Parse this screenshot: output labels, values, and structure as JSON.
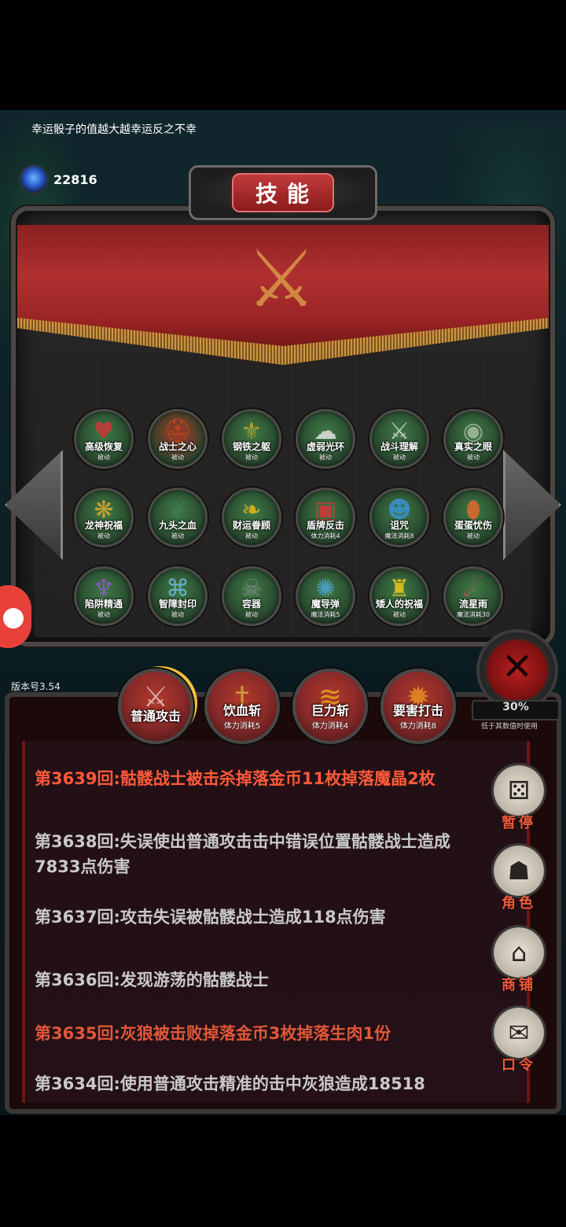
{
  "hint": "幸运骰子的值越大越幸运反之不幸",
  "currency": {
    "icon": "blue-gem-icon",
    "amount": "22816"
  },
  "panel": {
    "title": "技能"
  },
  "skills": [
    {
      "name": "高级恢复",
      "sub": "被动",
      "icon": "heart-icon",
      "bg": "#3f7a46"
    },
    {
      "name": "战士之心",
      "sub": "被动",
      "icon": "helmet-icon",
      "bg": "#a33a28"
    },
    {
      "name": "钢铁之躯",
      "sub": "被动",
      "icon": "armor-icon",
      "bg": "#3f7a46"
    },
    {
      "name": "虚弱光环",
      "sub": "被动",
      "icon": "ghost-icon",
      "bg": "#3f7a46"
    },
    {
      "name": "战斗理解",
      "sub": "被动",
      "icon": "sword-icon",
      "bg": "#3f7a46"
    },
    {
      "name": "真实之眼",
      "sub": "被动",
      "icon": "eye-icon",
      "bg": "#3f7a46"
    },
    {
      "name": "龙神祝福",
      "sub": "被动",
      "icon": "dragon-icon",
      "bg": "#3f7a46"
    },
    {
      "name": "九头之血",
      "sub": "被动",
      "icon": "hydra-icon",
      "bg": "#3f7a46"
    },
    {
      "name": "财运眷顾",
      "sub": "被动",
      "icon": "golden-wings-icon",
      "bg": "#3f7a46"
    },
    {
      "name": "盾牌反击",
      "sub": "体力消耗4",
      "icon": "shield-icon",
      "bg": "#3f7a46"
    },
    {
      "name": "诅咒",
      "sub": "魔法消耗8",
      "icon": "mask-icon",
      "bg": "#3f7a46"
    },
    {
      "name": "蛋蛋忧伤",
      "sub": "被动",
      "icon": "cracked-egg-icon",
      "bg": "#3f7a46"
    },
    {
      "name": "陷阱精通",
      "sub": "被动",
      "icon": "trap-icon",
      "bg": "#3f7a46"
    },
    {
      "name": "智障封印",
      "sub": "被动",
      "icon": "seal-icon",
      "bg": "#3f7a46"
    },
    {
      "name": "容器",
      "sub": "被动",
      "icon": "horned-skull-icon",
      "bg": "#3f7a46"
    },
    {
      "name": "魔导弹",
      "sub": "魔法消耗5",
      "icon": "magic-burst-icon",
      "bg": "#3f7a46"
    },
    {
      "name": "矮人的祝福",
      "sub": "被动",
      "icon": "dwarf-helmet-icon",
      "bg": "#3f7a46"
    },
    {
      "name": "流星雨",
      "sub": "魔法消耗30",
      "icon": "meteor-icon",
      "bg": "#3f7a46"
    }
  ],
  "version": "版本号3.54",
  "actions": [
    {
      "name": "普通攻击",
      "sub": "",
      "icon": "sword-strike-icon",
      "bg": "#8a2a2a"
    },
    {
      "name": "饮血斩",
      "sub": "体力消耗5",
      "icon": "blood-sword-icon",
      "bg": "#8a2a2a"
    },
    {
      "name": "巨力斩",
      "sub": "体力消耗4",
      "icon": "claw-icon",
      "bg": "#8a2a2a"
    },
    {
      "name": "要害打击",
      "sub": "体力消耗8",
      "icon": "explosion-icon",
      "bg": "#8a2a2a"
    }
  ],
  "close": {
    "badge": "30%",
    "note": "低于其数值时使用"
  },
  "log": [
    {
      "text": "第3639回:骷髅战士被击杀掉落金币11枚掉落魔晶2枚",
      "color": "red"
    },
    {
      "text": "第3638回:失误使出普通攻击击中错误位置骷髅战士造成7833点伤害",
      "color": "grey"
    },
    {
      "text": "第3637回:攻击失误被骷髅战士造成118点伤害",
      "color": "grey"
    },
    {
      "text": "第3636回:发现游荡的骷髅战士",
      "color": "grey"
    },
    {
      "text": "第3635回:灰狼被击败掉落金币3枚掉落生肉1份",
      "color": "orange"
    },
    {
      "text": "第3634回:使用普通攻击精准的击中灰狼造成18518",
      "color": "grey"
    }
  ],
  "side_menu": [
    {
      "label": "暂停",
      "icon": "dice-icon"
    },
    {
      "label": "角色",
      "icon": "hooded-figure-icon"
    },
    {
      "label": "商铺",
      "icon": "shop-icon"
    },
    {
      "label": "口令",
      "icon": "scroll-icon"
    }
  ]
}
